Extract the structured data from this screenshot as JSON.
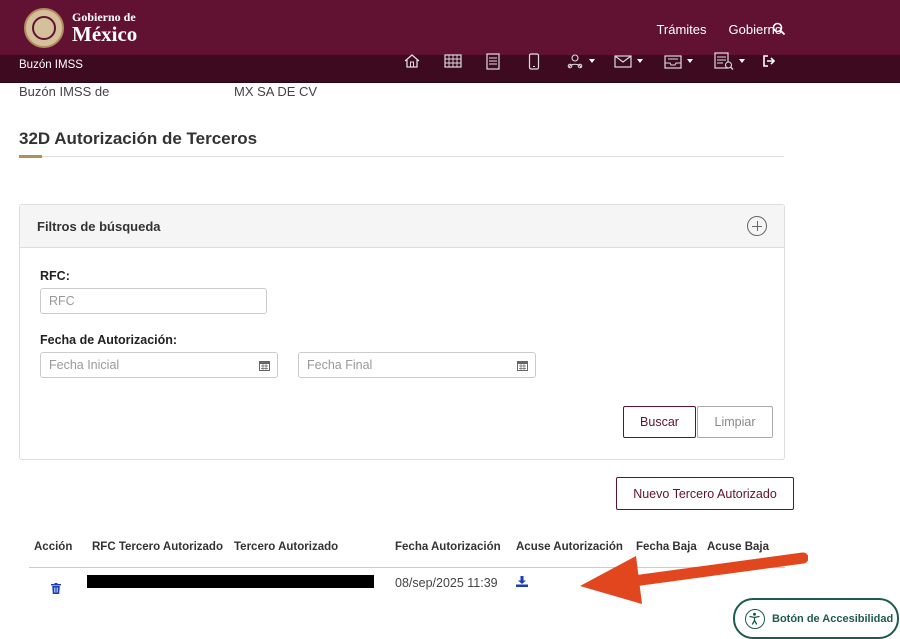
{
  "colors": {
    "brand": "#611232",
    "brand_dark": "#3d0a1f",
    "accent": "#b38e5d",
    "link_blue": "#1a3fb5",
    "arrow": "#e2461f",
    "a11y": "#1e5b4f"
  },
  "header": {
    "logo_line1": "Gobierno de",
    "logo_line2": "México",
    "nav_items": [
      "Trámites",
      "Gobierno"
    ],
    "search_icon": "search-icon"
  },
  "subbar": {
    "title": "Buzón IMSS",
    "icons": [
      "home-icon",
      "grid-icon",
      "document-icon",
      "mobile-icon",
      "users-icon",
      "mail-icon",
      "inbox-icon",
      "report-icon",
      "logout-icon"
    ]
  },
  "owner": {
    "label": "Buzón IMSS de",
    "value": "MX SA DE CV"
  },
  "page_title": "32D Autorización de Terceros",
  "filters": {
    "header": "Filtros de búsqueda",
    "rfc_label": "RFC:",
    "rfc_placeholder": "RFC",
    "date_label": "Fecha de Autorización:",
    "start_placeholder": "Fecha Inicial",
    "end_placeholder": "Fecha Final",
    "search_button": "Buscar",
    "clear_button": "Limpiar"
  },
  "new_button": "Nuevo Tercero Autorizado",
  "table": {
    "columns": [
      "Acción",
      "RFC Tercero Autorizado",
      "Tercero Autorizado",
      "Fecha Autorización",
      "Acuse Autorización",
      "Fecha Baja",
      "Acuse Baja"
    ],
    "rows": [
      {
        "action_icon": "trash-icon",
        "rfc": "",
        "tercero": "",
        "fecha_autorizacion": "08/sep/2025 11:39",
        "acuse_icon": "download-icon",
        "fecha_baja": "",
        "acuse_baja": ""
      }
    ]
  },
  "accessibility_button": "Botón de Accesibilidad"
}
